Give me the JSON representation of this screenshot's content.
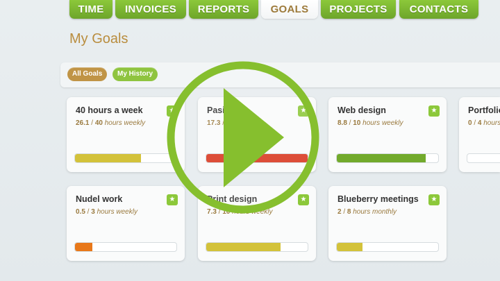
{
  "nav": {
    "tabs": [
      {
        "label": "TIME",
        "active": false
      },
      {
        "label": "INVOICES",
        "active": false
      },
      {
        "label": "REPORTS",
        "active": false
      },
      {
        "label": "GOALS",
        "active": true
      },
      {
        "label": "PROJECTS",
        "active": false
      },
      {
        "label": "CONTACTS",
        "active": false
      }
    ]
  },
  "page": {
    "title": "My Goals"
  },
  "filters": {
    "all_goals": "All Goals",
    "my_history": "My History"
  },
  "goals": [
    {
      "title": "40 hours a week",
      "current": "26.1",
      "target": "40",
      "unit": "hours weekly",
      "progress": 0.65,
      "color": "#d3c23a"
    },
    {
      "title": "Pasif",
      "current": "17.3",
      "target": "",
      "unit": "",
      "progress": 1.0,
      "color": "#d9361e"
    },
    {
      "title": "Web design",
      "current": "8.8",
      "target": "10",
      "unit": "hours weekly",
      "progress": 0.88,
      "color": "#72aa2c"
    },
    {
      "title": "Portfolio",
      "current": "0",
      "target": "4",
      "unit": "hours weekly",
      "progress": 0.0,
      "color": "#d3c23a"
    },
    {
      "title": "Nudel work",
      "current": "0.5",
      "target": "3",
      "unit": "hours weekly",
      "progress": 0.17,
      "color": "#e8781a"
    },
    {
      "title": "Print design",
      "current": "7.3",
      "target": "10",
      "unit": "hours weekly",
      "progress": 0.73,
      "color": "#d3c23a"
    },
    {
      "title": "Blueberry meetings",
      "current": "2",
      "target": "8",
      "unit": "hours monthly",
      "progress": 0.25,
      "color": "#d3c23a"
    }
  ],
  "overlay": {
    "icon": "play-icon",
    "color": "#86bf2e"
  }
}
